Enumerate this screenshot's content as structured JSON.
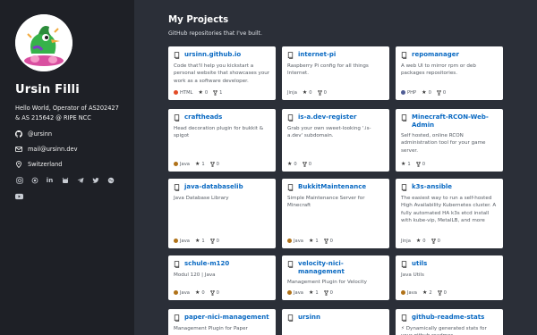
{
  "profile": {
    "name": "Ursin Filli",
    "bio": "Hello World, Operator of AS202427 & AS 215642 @ RIPE NCC",
    "github": "@ursinn",
    "email": "mail@ursinn.dev",
    "location": "Switzerland",
    "social_icons": [
      "instagram-icon",
      "camera-icon",
      "linkedin-icon",
      "fdroid-icon",
      "telegram-icon",
      "twitter-icon",
      "keybase-icon"
    ],
    "youtube_icon": "youtube-icon"
  },
  "page": {
    "title": "My Projects",
    "subtitle": "GitHub repositories that I've built."
  },
  "colors": {
    "html": "#e34c26",
    "java": "#b07219",
    "php": "#4f5d95",
    "link": "#0969c2"
  },
  "cards": [
    {
      "name": "ursinn.github.io",
      "desc": "Code that'll help you kickstart a personal website that showcases your work as a software developer.",
      "lang": "HTML",
      "lang_color": "#e34c26",
      "stars": "0",
      "forks": "1"
    },
    {
      "name": "internet-pi",
      "desc": "Raspberry Pi config for all things Internet.",
      "lang": "Jinja",
      "lang_color": "",
      "stars": "0",
      "forks": "0"
    },
    {
      "name": "repomanager",
      "desc": "A web UI to mirror rpm or deb packages repositories.",
      "lang": "PHP",
      "lang_color": "#4f5d95",
      "stars": "0",
      "forks": "0"
    },
    {
      "name": "craftheads",
      "desc": "Head decoration plugin for bukkit & spigot",
      "lang": "Java",
      "lang_color": "#b07219",
      "stars": "1",
      "forks": "0"
    },
    {
      "name": "is-a.dev-register",
      "desc": "Grab your own sweet-looking '.is-a.dev' subdomain.",
      "lang": "",
      "lang_color": "",
      "stars": "0",
      "forks": "0"
    },
    {
      "name": "Minecraft-RCON-Web-Admin",
      "desc": "Self hosted, online RCON administration tool for your game server.",
      "lang": "",
      "lang_color": "",
      "stars": "1",
      "forks": "0"
    },
    {
      "name": "java-databaselib",
      "desc": "Java Database Library",
      "lang": "Java",
      "lang_color": "#b07219",
      "stars": "1",
      "forks": "0"
    },
    {
      "name": "BukkitMaintenance",
      "desc": "Simple Maintenance Server for Minecraft",
      "lang": "Java",
      "lang_color": "#b07219",
      "stars": "1",
      "forks": "0"
    },
    {
      "name": "k3s-ansible",
      "desc": "The easiest way to run a self-hosted High Availability Kubernetes cluster. A fully automated HA k3s etcd install with kube-vip, MetalLB, and more",
      "lang": "Jinja",
      "lang_color": "",
      "stars": "0",
      "forks": "0"
    },
    {
      "name": "schule-m120",
      "desc": "Modul 120 | Java",
      "lang": "Java",
      "lang_color": "#b07219",
      "stars": "0",
      "forks": "0"
    },
    {
      "name": "velocity-nici-management",
      "desc": "Management Plugin for Velocity",
      "lang": "Java",
      "lang_color": "#b07219",
      "stars": "1",
      "forks": "0"
    },
    {
      "name": "utils",
      "desc": "Java Utils",
      "lang": "Java",
      "lang_color": "#b07219",
      "stars": "2",
      "forks": "0"
    },
    {
      "name": "paper-nici-management",
      "desc": "Management Plugin for Paper",
      "lang": "",
      "lang_color": "",
      "stars": "",
      "forks": ""
    },
    {
      "name": "ursinn",
      "desc": "",
      "lang": "",
      "lang_color": "",
      "stars": "",
      "forks": ""
    },
    {
      "name": "github-readme-stats",
      "desc": "⚡ Dynamically generated stats for your github readmes",
      "lang": "",
      "lang_color": "",
      "stars": "",
      "forks": ""
    }
  ]
}
